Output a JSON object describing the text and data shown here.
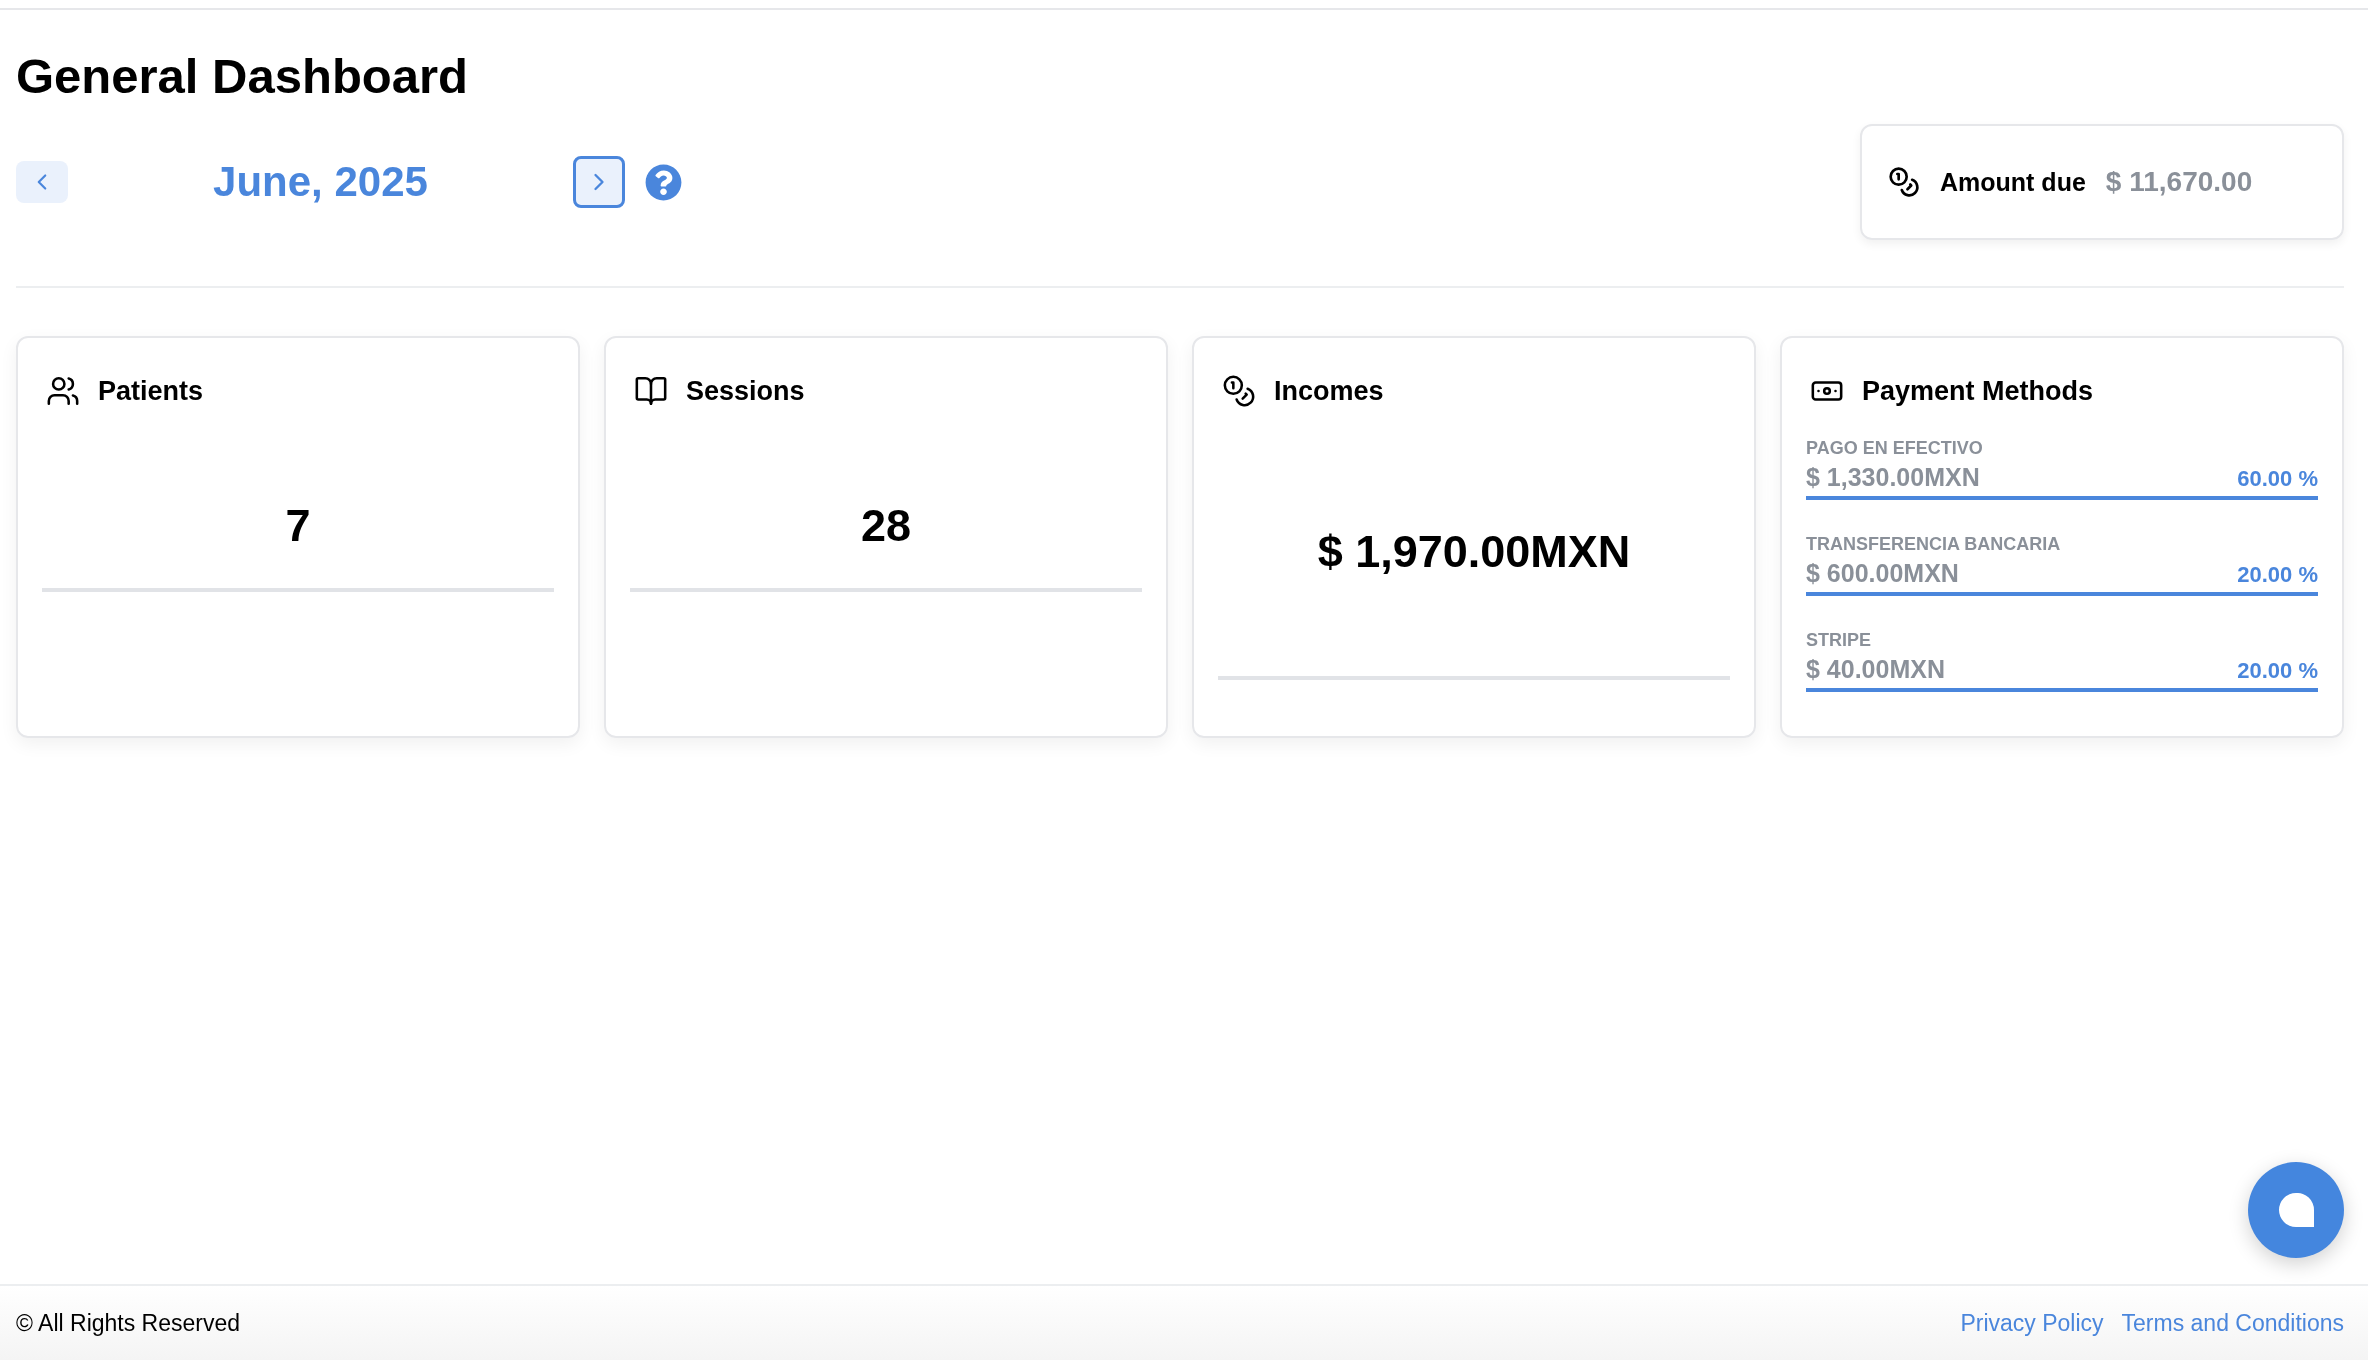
{
  "title": "General Dashboard",
  "period": {
    "label": "June, 2025"
  },
  "amount_due": {
    "label": "Amount due",
    "value": "$ 11,670.00"
  },
  "cards": [
    {
      "kind": "count",
      "title": "Patients",
      "value": "7"
    },
    {
      "kind": "count",
      "title": "Sessions",
      "value": "28"
    },
    {
      "kind": "money",
      "title": "Incomes",
      "value": "$ 1,970.00MXN"
    },
    {
      "kind": "breakdown",
      "title": "Payment Methods",
      "items": [
        {
          "name": "PAGO EN EFECTIVO",
          "amount": "$ 1,330.00MXN",
          "percent": "60.00 %"
        },
        {
          "name": "TRANSFERENCIA BANCARIA",
          "amount": "$ 600.00MXN",
          "percent": "20.00 %"
        },
        {
          "name": "STRIPE",
          "amount": "$ 40.00MXN",
          "percent": "20.00 %"
        }
      ]
    }
  ],
  "footer": {
    "copyright": "© All Rights Reserved",
    "links": [
      "Privacy Policy",
      "Terms and Conditions"
    ]
  }
}
